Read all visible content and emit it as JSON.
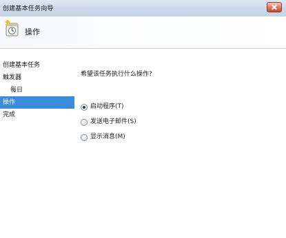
{
  "window": {
    "title": "创建基本任务向导"
  },
  "header": {
    "title": "操作",
    "icon": "task-wizard-icon"
  },
  "steps": [
    {
      "label": "创建基本任务",
      "level": 0,
      "selected": false
    },
    {
      "label": "触发器",
      "level": 0,
      "selected": false
    },
    {
      "label": "每日",
      "level": 1,
      "selected": false
    },
    {
      "label": "操作",
      "level": 0,
      "selected": true
    },
    {
      "label": "完成",
      "level": 0,
      "selected": false
    }
  ],
  "main": {
    "question": "希望该任务执行什么操作?",
    "options": [
      {
        "label": "启动程序(T)",
        "checked": true
      },
      {
        "label": "发送电子邮件(S)",
        "checked": false
      },
      {
        "label": "显示消息(M)",
        "checked": false
      }
    ]
  },
  "colors": {
    "selected_step_bg": "#3d8bdc",
    "title_bar": "#cfdcea"
  }
}
